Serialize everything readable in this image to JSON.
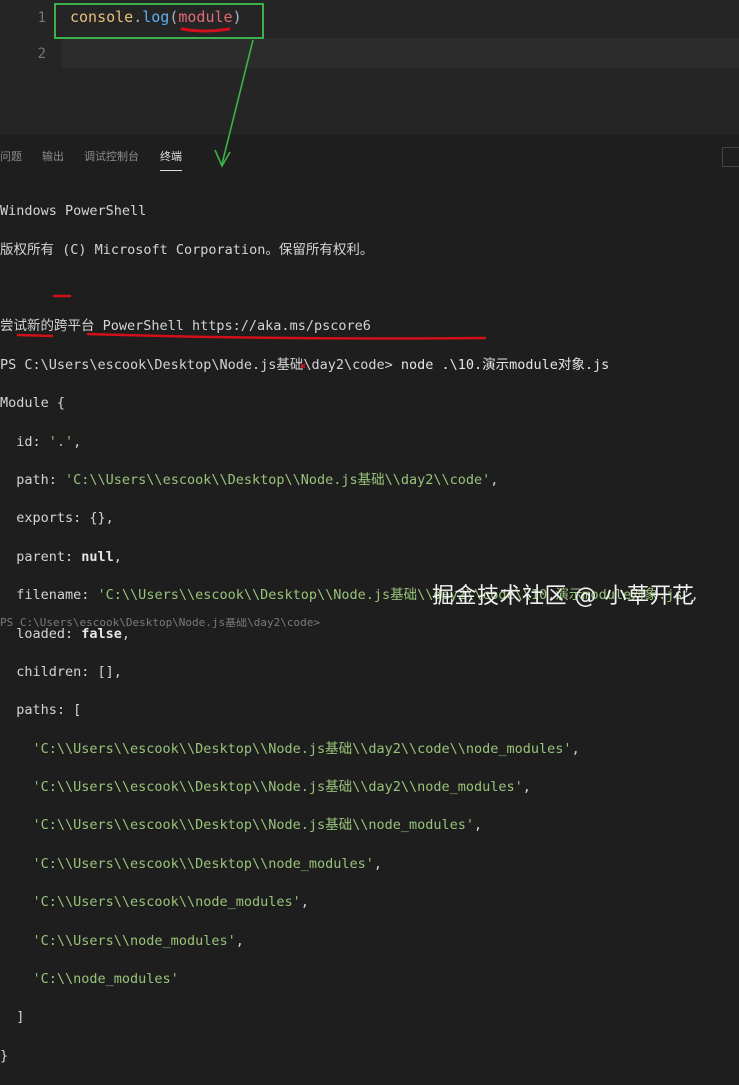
{
  "editor": {
    "line_numbers": [
      "1",
      "2"
    ],
    "code": {
      "object": "console",
      "dot": ".",
      "method": "log",
      "open": "(",
      "arg": "module",
      "close": ")"
    }
  },
  "panel": {
    "tabs": [
      "问题",
      "输出",
      "调试控制台",
      "终端"
    ],
    "active_tab": "终端"
  },
  "terminal": {
    "header1": "Windows PowerShell",
    "header2": "版权所有 (C) Microsoft Corporation。保留所有权利。",
    "header3": "尝试新的跨平台 PowerShell https://aka.ms/pscore6",
    "prompt": "PS C:\\Users\\escook\\Desktop\\Node.js基础\\day2\\code> ",
    "command": "node .\\10.演示module对象.js",
    "module_open": "Module {",
    "id_key": "  id: ",
    "id_val": "'.'",
    "path_key": "  path: ",
    "path_val": "'C:\\\\Users\\\\escook\\\\Desktop\\\\Node.js基础\\\\day2\\\\code'",
    "exports_line": "  exports: {},",
    "parent_key": "  parent: ",
    "parent_val": "null",
    "filename_key": "  filename: ",
    "filename_val": "'C:\\\\Users\\\\escook\\\\Desktop\\\\Node.js基础\\\\day2\\\\code\\\\10.演示module对象.js'",
    "loaded_key": "  loaded: ",
    "loaded_val": "false",
    "children_line": "  children: [],",
    "paths_open": "  paths: [",
    "paths": [
      "'C:\\\\Users\\\\escook\\\\Desktop\\\\Node.js基础\\\\day2\\\\code\\\\node_modules'",
      "'C:\\\\Users\\\\escook\\\\Desktop\\\\Node.js基础\\\\day2\\\\node_modules'",
      "'C:\\\\Users\\\\escook\\\\Desktop\\\\Node.js基础\\\\node_modules'",
      "'C:\\\\Users\\\\escook\\\\Desktop\\\\node_modules'",
      "'C:\\\\Users\\\\escook\\\\node_modules'",
      "'C:\\\\Users\\\\node_modules'",
      "'C:\\\\node_modules'"
    ],
    "paths_close": "  ]",
    "module_close": "}",
    "partial_prompt": "PS C:\\Users\\escook\\Desktop\\Node.js基础\\day2\\code> "
  },
  "watermark": "掘金技术社区 @ 小草开花",
  "colors": {
    "annotation_green": "#3cb04a",
    "annotation_red": "#d1101a",
    "string": "#98c379"
  }
}
